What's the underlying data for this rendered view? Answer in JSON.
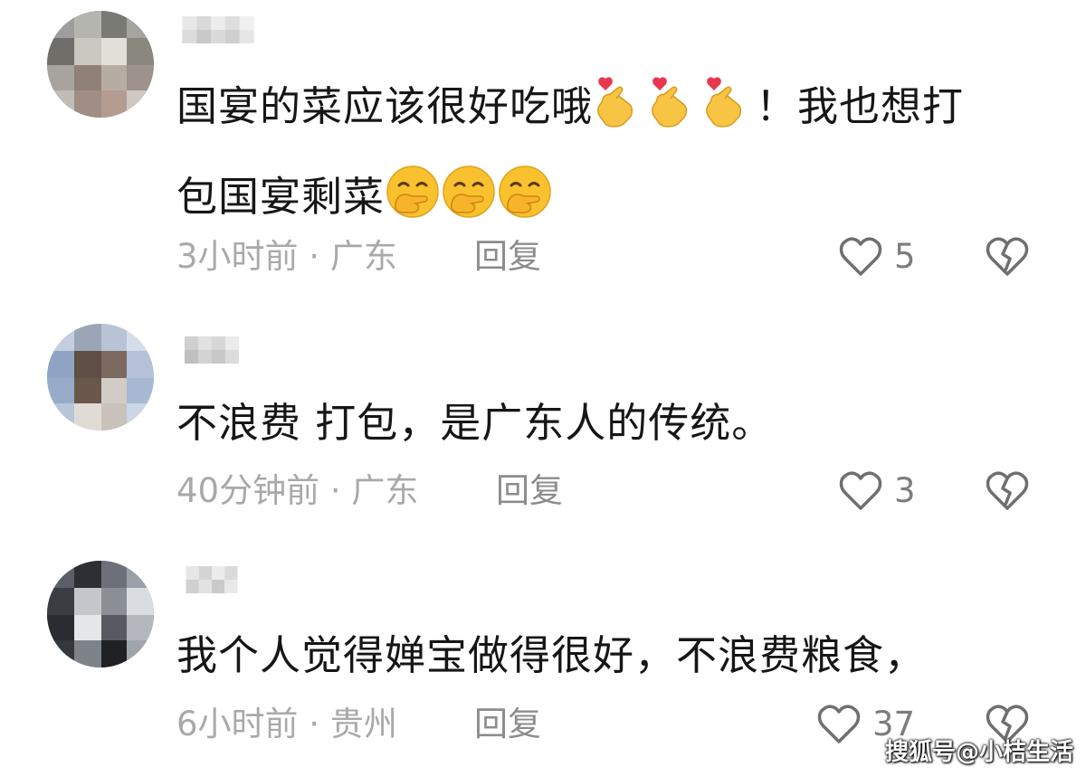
{
  "comments": [
    {
      "text_part1": "国宴的菜应该很好吃哦",
      "text_part2": "！我也想打",
      "text_part3": "包国宴剩菜",
      "time": "3小时前",
      "location": "广东",
      "reply_label": "回复",
      "likes": "5",
      "avatar_icon": "avatar-pixelated-icon"
    },
    {
      "text": "不浪费 打包，是广东人的传统。",
      "time": "40分钟前",
      "location": "广东",
      "reply_label": "回复",
      "likes": "3",
      "avatar_icon": "avatar-pixelated-icon"
    },
    {
      "text": "我个人觉得婵宝做得很好，不浪费粮食，",
      "time": "6小时前",
      "location": "贵州",
      "reply_label": "回复",
      "likes": "37",
      "avatar_icon": "avatar-pixelated-icon"
    }
  ],
  "separator": " · ",
  "watermark": "搜狐号@小桔生活",
  "colors": {
    "text": "#161616",
    "meta": "#a9a9a9",
    "icon": "#6f6f6f",
    "heart_emoji": "#e8384f",
    "hand_emoji": "#f7c444"
  }
}
